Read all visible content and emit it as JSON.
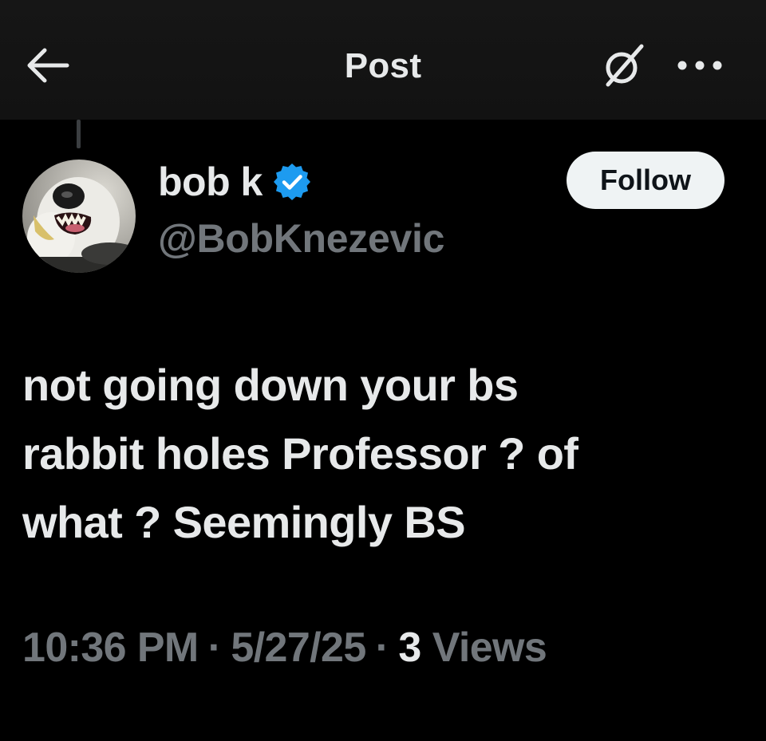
{
  "header": {
    "title": "Post",
    "back_icon": "arrow-left-icon",
    "grok_icon": "grok-icon",
    "more_icon": "more-dots-icon"
  },
  "author": {
    "display_name": "bob k",
    "handle": "@BobKnezevic",
    "verified": true,
    "verified_color": "#1d9bf0",
    "avatar_icon": "dog-avatar-icon"
  },
  "follow_button": {
    "label": "Follow"
  },
  "post": {
    "lines": [
      "not going down your bs",
      "rabbit holes Professor ? of",
      "what ? Seemingly BS"
    ]
  },
  "meta": {
    "time": "10:36 PM",
    "separator": "·",
    "date": "5/27/25",
    "views_count": "3",
    "views_label": "Views"
  },
  "colors": {
    "background": "#000000",
    "text_primary": "#e7e9ea",
    "text_secondary": "#71767b",
    "follow_bg": "#eff3f4"
  }
}
